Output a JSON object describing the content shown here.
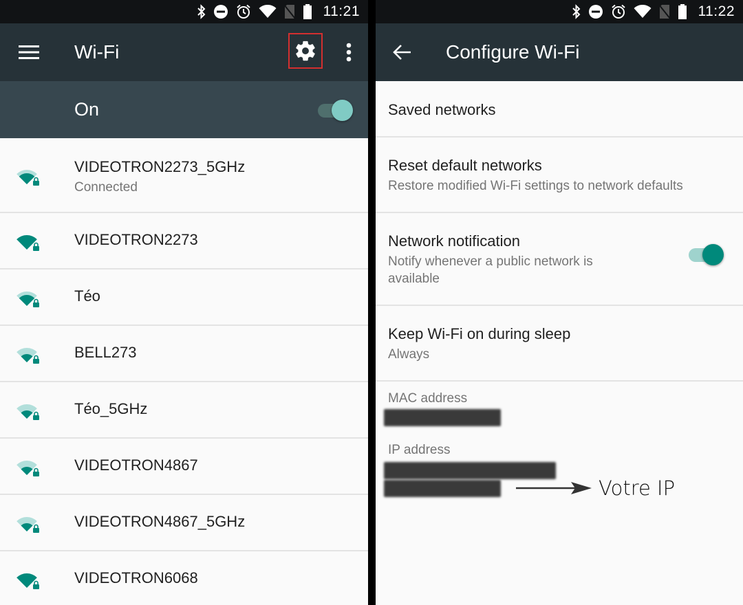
{
  "left_screen": {
    "status_bar": {
      "icons": [
        "bluetooth-icon",
        "do-not-disturb-icon",
        "alarm-icon",
        "wifi-signal-icon",
        "no-sim-icon",
        "battery-icon"
      ],
      "time": "11:21"
    },
    "app_bar": {
      "nav_icon": "hamburger-menu-icon",
      "title": "Wi-Fi",
      "actions": [
        "settings-gear-icon",
        "more-vert-icon"
      ],
      "highlighted_action": "settings-gear-icon",
      "highlight_color": "#d32f2f"
    },
    "master_switch": {
      "label": "On",
      "checked": true
    },
    "networks": [
      {
        "ssid": "VIDEOTRON2273_5GHz",
        "status": "Connected",
        "signal_bars": 3,
        "secured": true
      },
      {
        "ssid": "VIDEOTRON2273",
        "status": "",
        "signal_bars": 4,
        "secured": true
      },
      {
        "ssid": "Téo",
        "status": "",
        "signal_bars": 3,
        "secured": true
      },
      {
        "ssid": "BELL273",
        "status": "",
        "signal_bars": 2,
        "secured": true
      },
      {
        "ssid": "Téo_5GHz",
        "status": "",
        "signal_bars": 2,
        "secured": true
      },
      {
        "ssid": "VIDEOTRON4867",
        "status": "",
        "signal_bars": 2,
        "secured": true
      },
      {
        "ssid": "VIDEOTRON4867_5GHz",
        "status": "",
        "signal_bars": 2,
        "secured": true
      },
      {
        "ssid": "VIDEOTRON6068",
        "status": "",
        "signal_bars": 4,
        "secured": true
      }
    ]
  },
  "right_screen": {
    "status_bar": {
      "icons": [
        "bluetooth-icon",
        "do-not-disturb-icon",
        "alarm-icon",
        "wifi-signal-icon",
        "no-sim-icon",
        "battery-icon"
      ],
      "time": "11:22"
    },
    "app_bar": {
      "nav_icon": "back-arrow-icon",
      "title": "Configure Wi-Fi"
    },
    "preferences": {
      "saved": {
        "title": "Saved networks"
      },
      "reset": {
        "title": "Reset default networks",
        "summary": "Restore modified Wi-Fi settings to network defaults"
      },
      "notify": {
        "title": "Network notification",
        "summary": "Notify whenever a public network is available",
        "checked": true
      },
      "sleep": {
        "title": "Keep Wi-Fi on during sleep",
        "summary": "Always"
      }
    },
    "info": {
      "mac_label": "MAC address",
      "mac_value": "[redacted]",
      "ip_label": "IP address",
      "ip_value": "[redacted]"
    },
    "annotation": {
      "text": "Votre IP"
    }
  },
  "colors": {
    "accent": "#00897b",
    "accent_light": "#80cbc4",
    "app_bar": "#263238",
    "switch_bar": "#37474f",
    "status_bar": "#111315"
  }
}
